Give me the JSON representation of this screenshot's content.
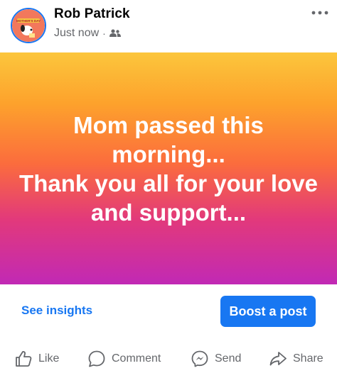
{
  "post": {
    "author": "Rob Patrick",
    "timestamp": "Just now",
    "separator": "·",
    "audience_icon": "friends-icon",
    "text": "Mom passed this morning...\nThank you all for your love and support...",
    "avatar_badge": "MOTHER'S DAY"
  },
  "footer": {
    "insights_label": "See insights",
    "boost_label": "Boost a post"
  },
  "actions": [
    {
      "label": "Like",
      "icon": "like-icon"
    },
    {
      "label": "Comment",
      "icon": "comment-icon"
    },
    {
      "label": "Send",
      "icon": "messenger-icon"
    },
    {
      "label": "Share",
      "icon": "share-icon"
    }
  ],
  "colors": {
    "accent": "#1877f2",
    "gradient_top": "#fcc63c",
    "gradient_mid": "#fb6c3d",
    "gradient_bottom": "#c129b5"
  }
}
